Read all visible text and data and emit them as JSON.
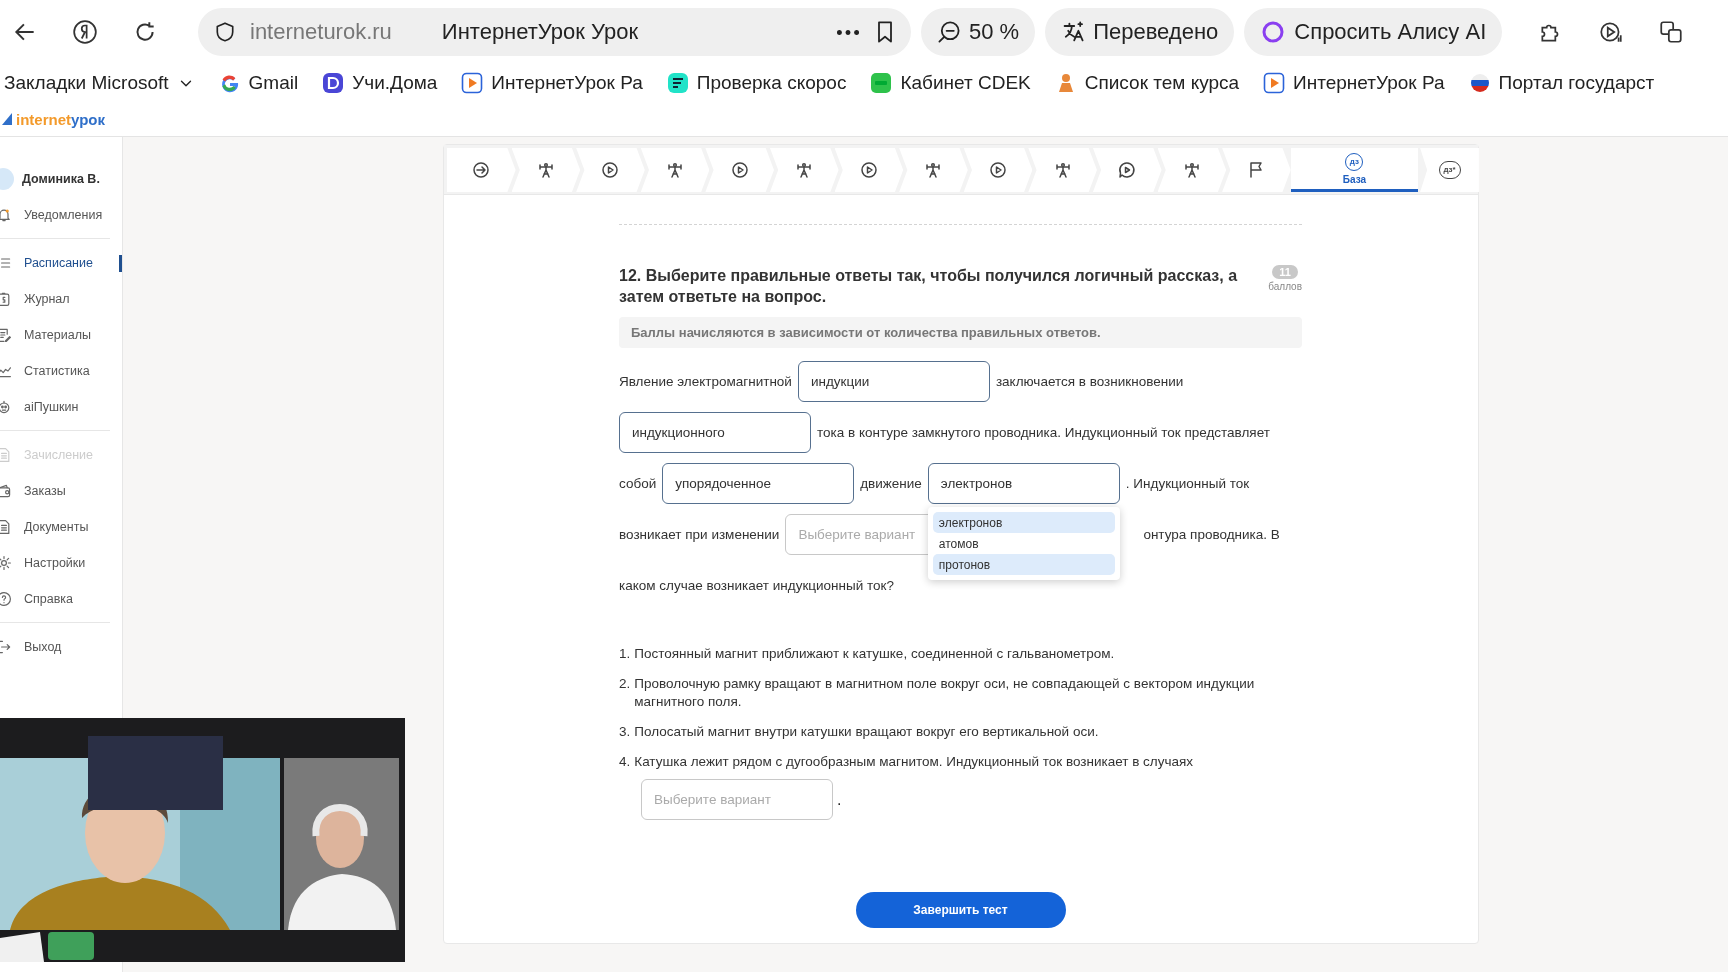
{
  "browser": {
    "url": "interneturok.ru",
    "page_title": "ИнтернетУрок Урок",
    "zoom": "50 %",
    "translated": "Переведено",
    "alice": "Спросить Алису AI"
  },
  "bookmarks": [
    {
      "label": "Закладки Microsoft",
      "kind": "folder"
    },
    {
      "label": "Gmail",
      "kind": "gmail"
    },
    {
      "label": "Учи.Дома",
      "kind": "uchi"
    },
    {
      "label": "ИнтернетУрок Ра",
      "kind": "play"
    },
    {
      "label": "Проверка скорос",
      "kind": "speed"
    },
    {
      "label": "Кабинет CDEK",
      "kind": "cdek"
    },
    {
      "label": "Список тем курса",
      "kind": "list"
    },
    {
      "label": "ИнтернетУрок Ра",
      "kind": "play"
    },
    {
      "label": "Портал государст",
      "kind": "gov"
    }
  ],
  "logo": {
    "first": "internet",
    "second": "урок"
  },
  "sidebar": {
    "user": {
      "name": "Доминика В."
    },
    "groups": [
      [
        {
          "label": "Уведомления",
          "kind": "bell",
          "selected": false,
          "disabled": false
        }
      ],
      [
        {
          "label": "Расписание",
          "kind": "list",
          "selected": true,
          "disabled": false
        },
        {
          "label": "Журнал",
          "kind": "journal",
          "selected": false,
          "disabled": false
        },
        {
          "label": "Материалы",
          "kind": "materials",
          "selected": false,
          "disabled": false
        },
        {
          "label": "Статистика",
          "kind": "stats",
          "selected": false,
          "disabled": false
        },
        {
          "label": "aiПушкин",
          "kind": "bot",
          "selected": false,
          "disabled": false
        }
      ],
      [
        {
          "label": "Зачисление",
          "kind": "doc",
          "selected": false,
          "disabled": true
        },
        {
          "label": "Заказы",
          "kind": "wallet",
          "selected": false,
          "disabled": false
        },
        {
          "label": "Документы",
          "kind": "doc",
          "selected": false,
          "disabled": false
        },
        {
          "label": "Настройки",
          "kind": "gear",
          "selected": false,
          "disabled": false
        },
        {
          "label": "Справка",
          "kind": "help",
          "selected": false,
          "disabled": false
        }
      ],
      [
        {
          "label": "Выход",
          "kind": "exit",
          "selected": false,
          "disabled": false
        }
      ]
    ]
  },
  "steps": [
    {
      "kind": "start",
      "selected": false
    },
    {
      "kind": "trainer",
      "selected": false
    },
    {
      "kind": "video",
      "selected": false
    },
    {
      "kind": "trainer",
      "selected": false
    },
    {
      "kind": "video",
      "selected": false
    },
    {
      "kind": "trainer",
      "selected": false
    },
    {
      "kind": "video",
      "selected": false
    },
    {
      "kind": "trainer",
      "selected": false
    },
    {
      "kind": "video",
      "selected": false
    },
    {
      "kind": "trainer",
      "selected": false
    },
    {
      "kind": "chat",
      "selected": false
    },
    {
      "kind": "trainer",
      "selected": false
    },
    {
      "kind": "flag",
      "selected": false
    },
    {
      "kind": "homework",
      "icon_text": "дз",
      "label": "База",
      "selected": true
    },
    {
      "kind": "homework",
      "icon_text": "дз*",
      "selected": false
    }
  ],
  "question": {
    "title": "12. Выберите правильные ответы так, чтобы получился логичный рассказ, а затем ответьте на вопрос.",
    "points": "11",
    "points_label": "баллов",
    "note": "Баллы начисляются в зависимости от количества правильных ответов.",
    "story": [
      [
        {
          "kind": "text",
          "text": "Явление электромагнитной"
        },
        {
          "kind": "field",
          "value": "индукции"
        },
        {
          "kind": "text",
          "text": "заключается в возникновении"
        }
      ],
      [
        {
          "kind": "field",
          "value": "индукционного"
        },
        {
          "kind": "text",
          "text": "тока в контуре замкнутого проводника. Индукционный ток представляет"
        }
      ],
      [
        {
          "kind": "text",
          "text": "собой"
        },
        {
          "kind": "field",
          "value": "упорядоченное"
        },
        {
          "kind": "text",
          "text": "движение"
        },
        {
          "kind": "field",
          "value": "электронов",
          "open": true,
          "options": [
            {
              "label": "электронов",
              "highlighted": true
            },
            {
              "label": "атомов",
              "highlighted": false
            },
            {
              "label": "протонов",
              "highlighted": true
            }
          ]
        },
        {
          "kind": "text",
          "text": ". Индукционный ток"
        }
      ],
      [
        {
          "kind": "text",
          "text": "возникает при изменении"
        },
        {
          "kind": "field",
          "placeholder": "Выберите вариант"
        },
        {
          "kind": "covered_text",
          "text": "онтура проводника. В"
        }
      ],
      [
        {
          "kind": "text",
          "text": "каком случае возникает индукционный ток?"
        }
      ]
    ],
    "options": [
      {
        "number": "1.",
        "text": "Постоянный магнит приближают к катушке, соединенной с гальванометром."
      },
      {
        "number": "2.",
        "text": "Проволочную рамку вращают в магнитном поле вокруг оси, не совпадающей с вектором индукции магнитного поля."
      },
      {
        "number": "3.",
        "text": "Полосатый магнит внутри катушки вращают вокруг его вертикальной оси."
      },
      {
        "number": "4.",
        "text": "Катушка лежит рядом с дугообразным магнитом. Индукционный ток возникает в случаях"
      }
    ],
    "answer": {
      "placeholder": "Выберите вариант",
      "after": "."
    },
    "submit": "Завершить тест"
  }
}
